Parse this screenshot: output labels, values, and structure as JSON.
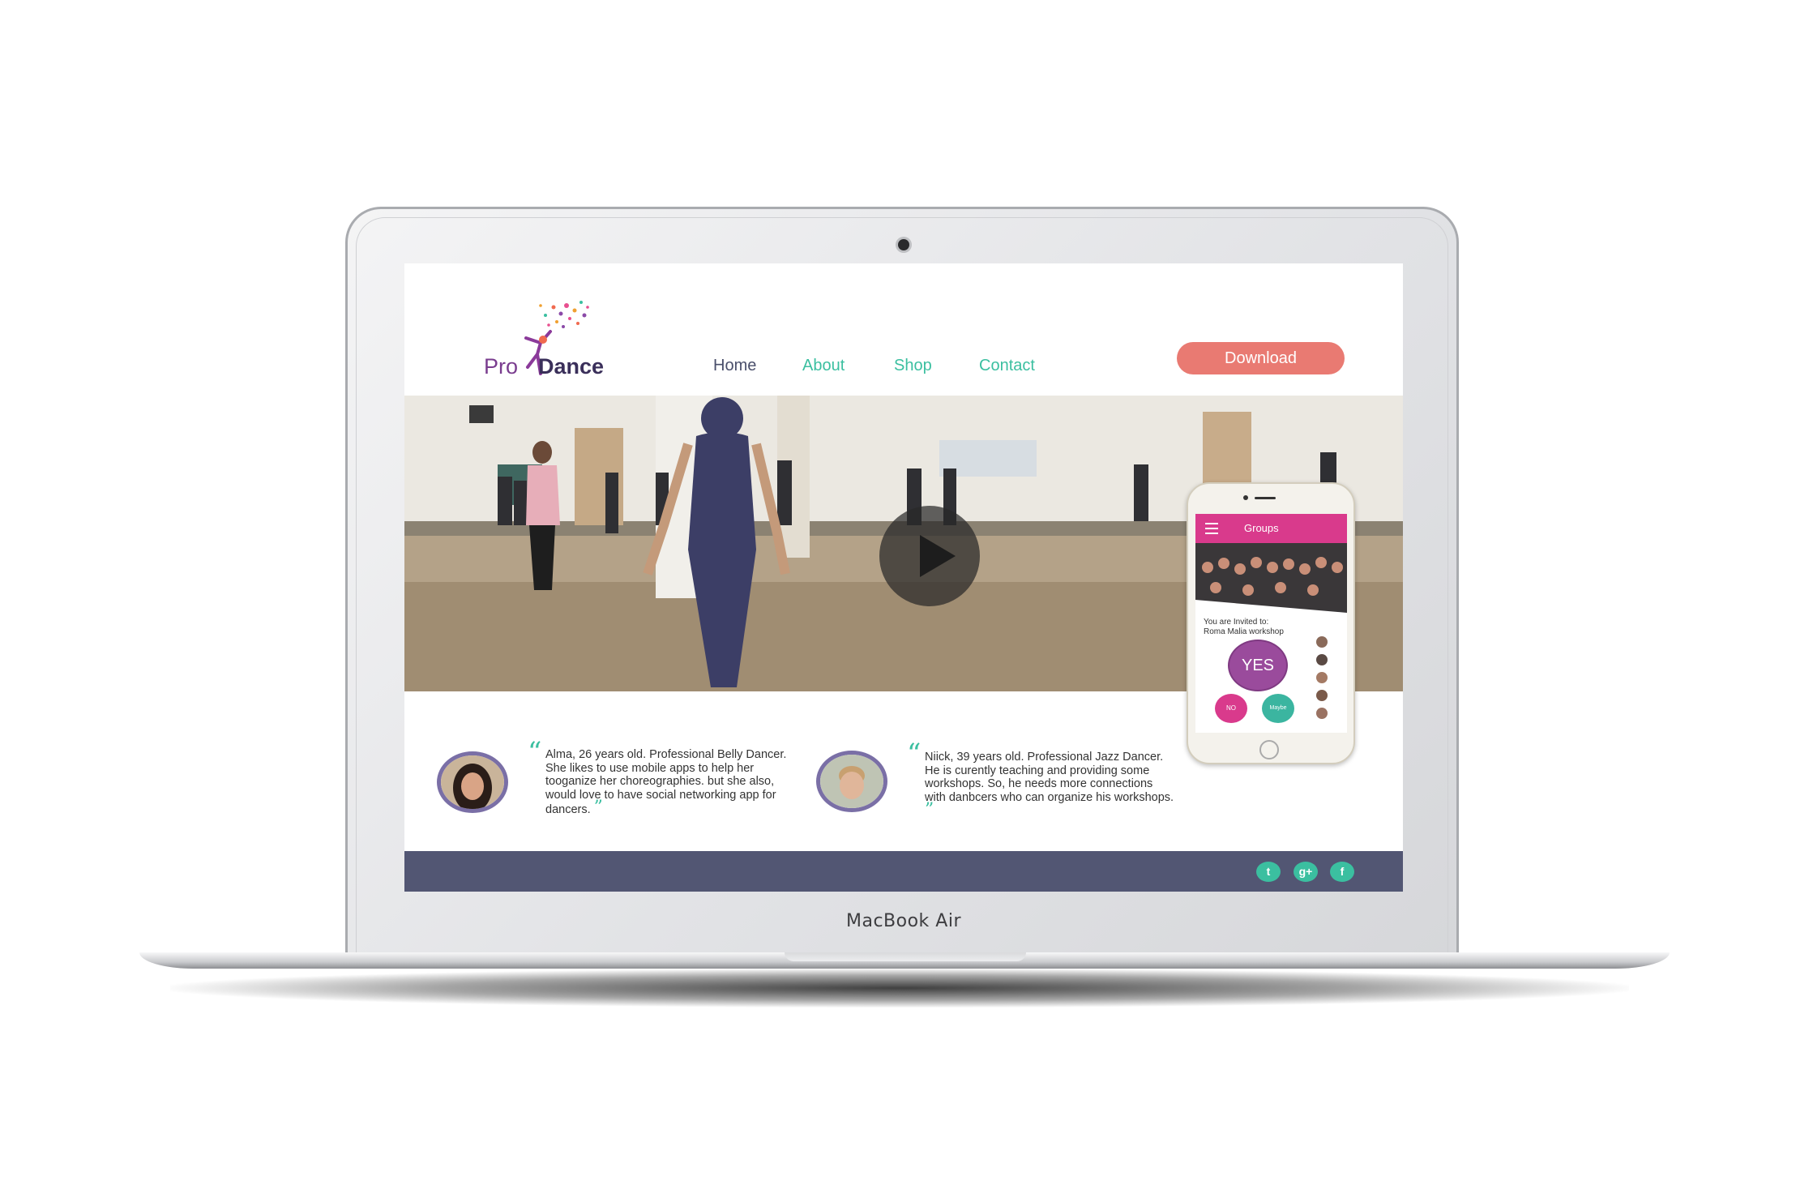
{
  "device": {
    "brand_label": "MacBook Air"
  },
  "site": {
    "logo_pro": "Pro",
    "logo_dance": "Dance",
    "nav": [
      {
        "label": "Home"
      },
      {
        "label": "About"
      },
      {
        "label": "Shop"
      },
      {
        "label": "Contact"
      }
    ],
    "download_label": "Download"
  },
  "phone": {
    "header_title": "Groups",
    "invite_line1": "You are Invited to:",
    "invite_line2": "Roma Malia workshop",
    "yes_label": "YES",
    "no_label": "NO",
    "maybe_label": "Maybe"
  },
  "testimonials": [
    {
      "text": "Alma, 26 years old. Professional Belly Dancer. She likes to use mobile apps to help her tooganize her choreographies. but she also, would love to have social networking app for dancers."
    },
    {
      "text": "Niick, 39 years old. Professional Jazz Dancer. He is curently teaching and providing some workshops. So, he needs more connections with danbcers who can organize his workshops."
    }
  ],
  "quote_open_mark": "“",
  "quote_close_mark": "”",
  "footer": {
    "social": [
      {
        "name": "twitter-icon",
        "glyph": "t"
      },
      {
        "name": "google-plus-icon",
        "glyph": "g+"
      },
      {
        "name": "facebook-icon",
        "glyph": "f"
      }
    ]
  },
  "colors": {
    "accent_teal": "#3bbfa0",
    "download_button": "#e97a72",
    "footer": "#525673",
    "phone_header": "#d93a8c",
    "yes_button": "#9a4b9c"
  }
}
